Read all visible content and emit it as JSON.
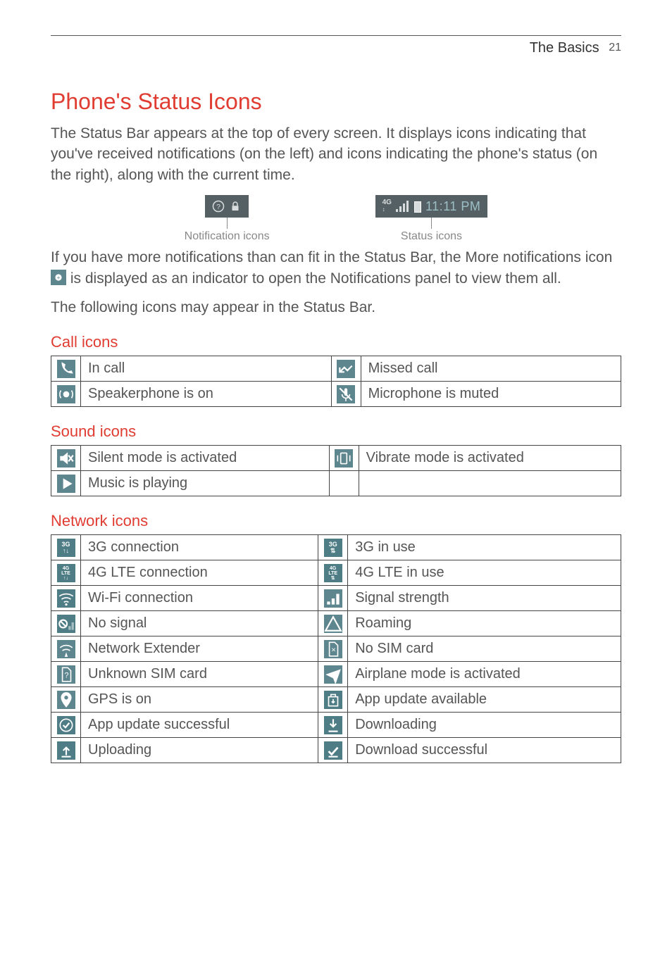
{
  "header": {
    "section": "The Basics",
    "page": "21"
  },
  "title": "Phone's Status Icons",
  "intro": "The Status Bar appears at the top of every screen. It displays icons indicating that you've received notifications (on the left) and icons indicating the phone's status (on the right), along with the current time.",
  "diagram": {
    "notification_caption": "Notification icons",
    "status_caption": "Status icons",
    "time_text": "11:11 PM",
    "lte_label": "4G LTE"
  },
  "more_notif_1": "If you have more notifications than can fit in the Status Bar, the More notifications icon ",
  "more_notif_2": " is displayed as an indicator to open the Notifications panel to view them all.",
  "following": "The following icons may appear in the Status Bar.",
  "sections": {
    "call": {
      "heading": "Call icons",
      "rows": [
        {
          "l_icon": "phone-icon",
          "l_label": "In call",
          "r_icon": "missed-call-icon",
          "r_label": "Missed call"
        },
        {
          "l_icon": "speakerphone-icon",
          "l_label": "Speakerphone is on",
          "r_icon": "mic-muted-icon",
          "r_label": "Microphone is muted"
        }
      ]
    },
    "sound": {
      "heading": "Sound icons",
      "rows": [
        {
          "l_icon": "silent-icon",
          "l_label": "Silent mode is activated",
          "r_icon": "vibrate-icon",
          "r_label": "Vibrate mode is activated"
        },
        {
          "l_icon": "play-icon",
          "l_label": "Music is playing",
          "r_icon": "",
          "r_label": ""
        }
      ]
    },
    "network": {
      "heading": "Network icons",
      "rows": [
        {
          "l_icon": "3g-icon",
          "l_label": "3G connection",
          "r_icon": "3g-use-icon",
          "r_label": "3G in use"
        },
        {
          "l_icon": "4g-lte-icon",
          "l_label": "4G LTE connection",
          "r_icon": "4g-lte-use-icon",
          "r_label": "4G LTE in use"
        },
        {
          "l_icon": "wifi-icon",
          "l_label": "Wi-Fi connection",
          "r_icon": "signal-icon",
          "r_label": "Signal strength"
        },
        {
          "l_icon": "no-signal-icon",
          "l_label": "No signal",
          "r_icon": "roaming-icon",
          "r_label": "Roaming"
        },
        {
          "l_icon": "network-extender-icon",
          "l_label": "Network Extender",
          "r_icon": "no-sim-icon",
          "r_label": "No SIM card"
        },
        {
          "l_icon": "unknown-sim-icon",
          "l_label": "Unknown SIM card",
          "r_icon": "airplane-icon",
          "r_label": "Airplane mode is activated"
        },
        {
          "l_icon": "gps-icon",
          "l_label": "GPS is on",
          "r_icon": "app-update-icon",
          "r_label": "App update available"
        },
        {
          "l_icon": "update-success-icon",
          "l_label": "App update successful",
          "r_icon": "downloading-icon",
          "r_label": "Downloading"
        },
        {
          "l_icon": "uploading-icon",
          "l_label": "Uploading",
          "r_icon": "download-success-icon",
          "r_label": "Download successful"
        }
      ]
    }
  }
}
